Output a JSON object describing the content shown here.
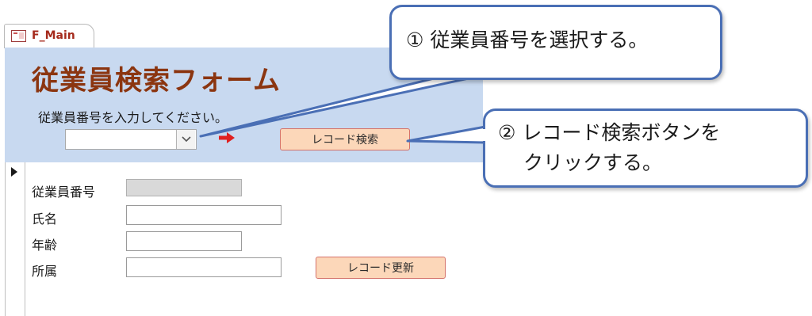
{
  "tab": {
    "icon": "form-icon",
    "label": "F_Main"
  },
  "header": {
    "title": "従業員検索フォーム",
    "prompt": "従業員番号を入力してください。",
    "employee_combo": {
      "value": ""
    },
    "search_button": "レコード検索"
  },
  "detail": {
    "fields": [
      {
        "label": "従業員番号",
        "value": ""
      },
      {
        "label": "氏名",
        "value": ""
      },
      {
        "label": "年齢",
        "value": ""
      },
      {
        "label": "所属",
        "value": ""
      }
    ],
    "update_button": "レコード更新"
  },
  "callouts": {
    "step1": "① 従業員番号を選択する。",
    "step2_line1": "② レコード検索ボタンを",
    "step2_line2": "クリックする。"
  },
  "colors": {
    "header_bg": "#c8d9f0",
    "title": "#8b3510",
    "button_bg": "#fcd7b9",
    "button_border": "#d4726a",
    "callout_border": "#4a6fb5",
    "arrow": "#e02020"
  }
}
